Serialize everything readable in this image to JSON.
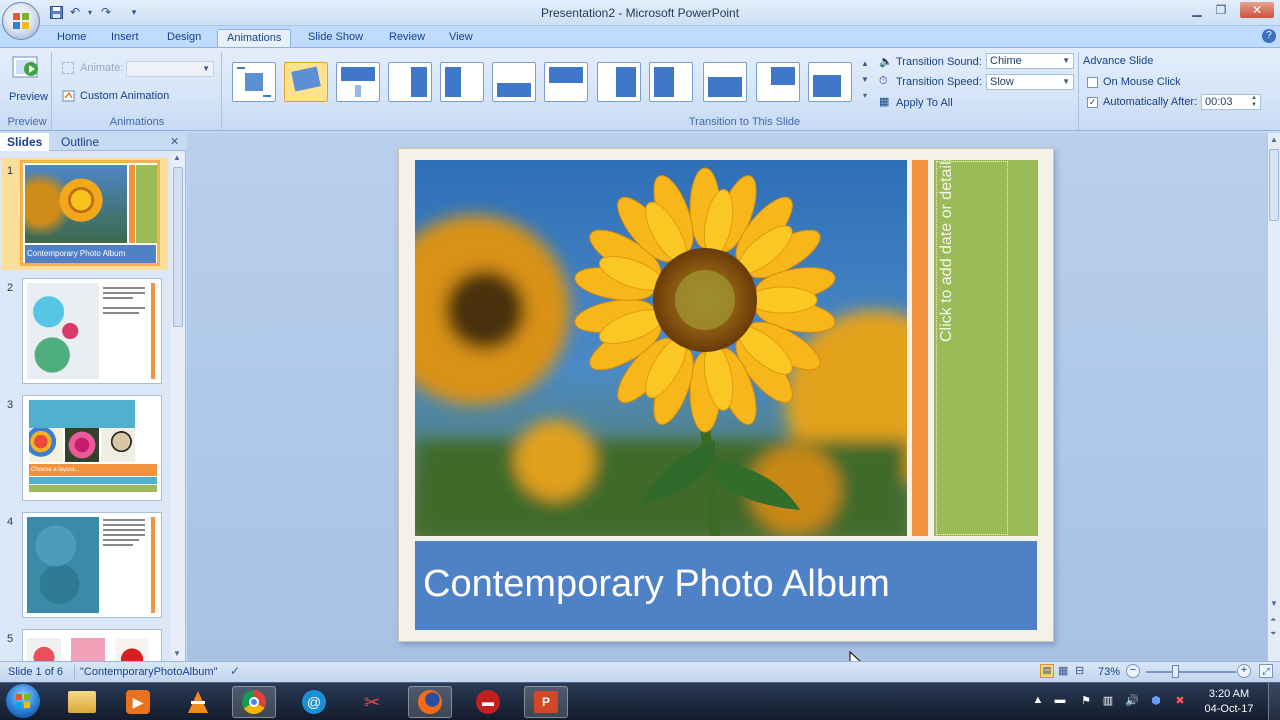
{
  "window": {
    "title": "Presentation2 - Microsoft PowerPoint"
  },
  "tabs": [
    "Home",
    "Insert",
    "Design",
    "Animations",
    "Slide Show",
    "Review",
    "View"
  ],
  "ribbon": {
    "preview_label": "Preview",
    "preview_group": "Preview",
    "animate_label": "Animate:",
    "custom_animation": "Custom Animation",
    "animations_group": "Animations",
    "transition_group": "Transition to This Slide",
    "transition_sound_label": "Transition Sound:",
    "transition_sound_value": "Chime",
    "transition_speed_label": "Transition Speed:",
    "transition_speed_value": "Slow",
    "apply_to_all": "Apply To All",
    "advance_slide": "Advance Slide",
    "on_mouse_click": "On Mouse Click",
    "automatically_after": "Automatically After:",
    "automatically_after_value": "00:03",
    "on_mouse_click_checked": false,
    "automatically_after_checked": true
  },
  "left_pane": {
    "tabs": [
      "Slides",
      "Outline"
    ],
    "slide_numbers": [
      "1",
      "2",
      "3",
      "4",
      "5"
    ],
    "thumb1_caption": "Contemporary Photo Album",
    "thumb3_caption": "Choose a layout..."
  },
  "slide": {
    "title": "Contemporary Photo Album",
    "side_placeholder": "Click to add date or details"
  },
  "status": {
    "slide_info": "Slide 1 of 6",
    "theme": "\"ContemporaryPhotoAlbum\"",
    "zoom": "73%"
  },
  "taskbar": {
    "time": "3:20 AM",
    "date": "04-Oct-17"
  },
  "colors": {
    "accent_orange": "#f0923e",
    "accent_green": "#9bbb59",
    "title_blue": "#4f81c7"
  }
}
